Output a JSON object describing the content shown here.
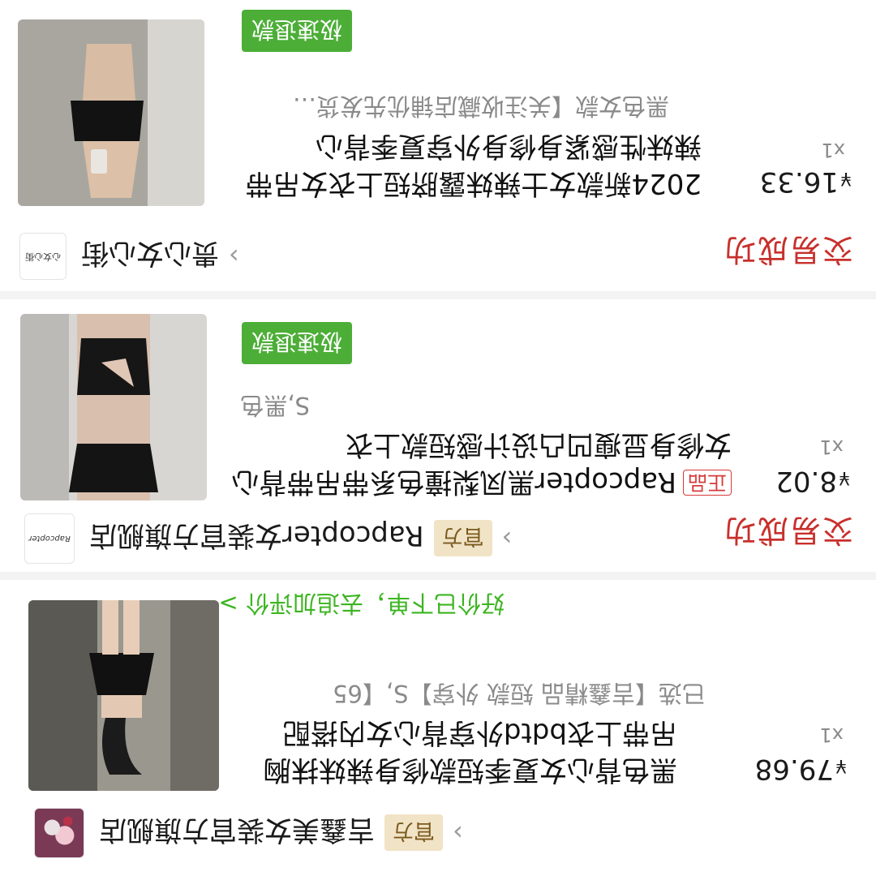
{
  "orders": [
    {
      "shop_name": "吉鑫美女装官方旗舰店",
      "shop_badge": "官方",
      "price_symbol": "¥",
      "price": "79.68",
      "qty": "x1",
      "title": "黑色背心女夏季短款修身辣妹抹胸吊带上衣bdtd外穿背心女内搭配",
      "spec": "已选【吉鑫精品 短款 外穿】S,【65",
      "promo": "好价已下单，去追加评价 >"
    },
    {
      "status": "交易成功",
      "shop_name": "Rapcopter女装官方旗舰店",
      "shop_badge": "官方",
      "shop_logo_text": "Rapcopter",
      "price_symbol": "¥",
      "price": "8.02",
      "qty": "x1",
      "tag_red": "正品",
      "title": "Rapcopter黑凤梨撞色系带吊带背心女修身显瘦凹凸设计感短款上衣",
      "spec": "S,黑色",
      "tag_green": "极速退款"
    },
    {
      "status": "交易成功",
      "shop_name": "贵心女心街",
      "shop_logo_text": "心女心街",
      "price_symbol": "¥",
      "price": "16.33",
      "qty": "x1",
      "title": "2024新款女士辣妹露脐短上衣女吊带辣妹性感紧身修身外穿夏季背心",
      "spec": "黑色女款【关注收藏店铺优先发货…",
      "tag_green": "极速退款"
    }
  ]
}
